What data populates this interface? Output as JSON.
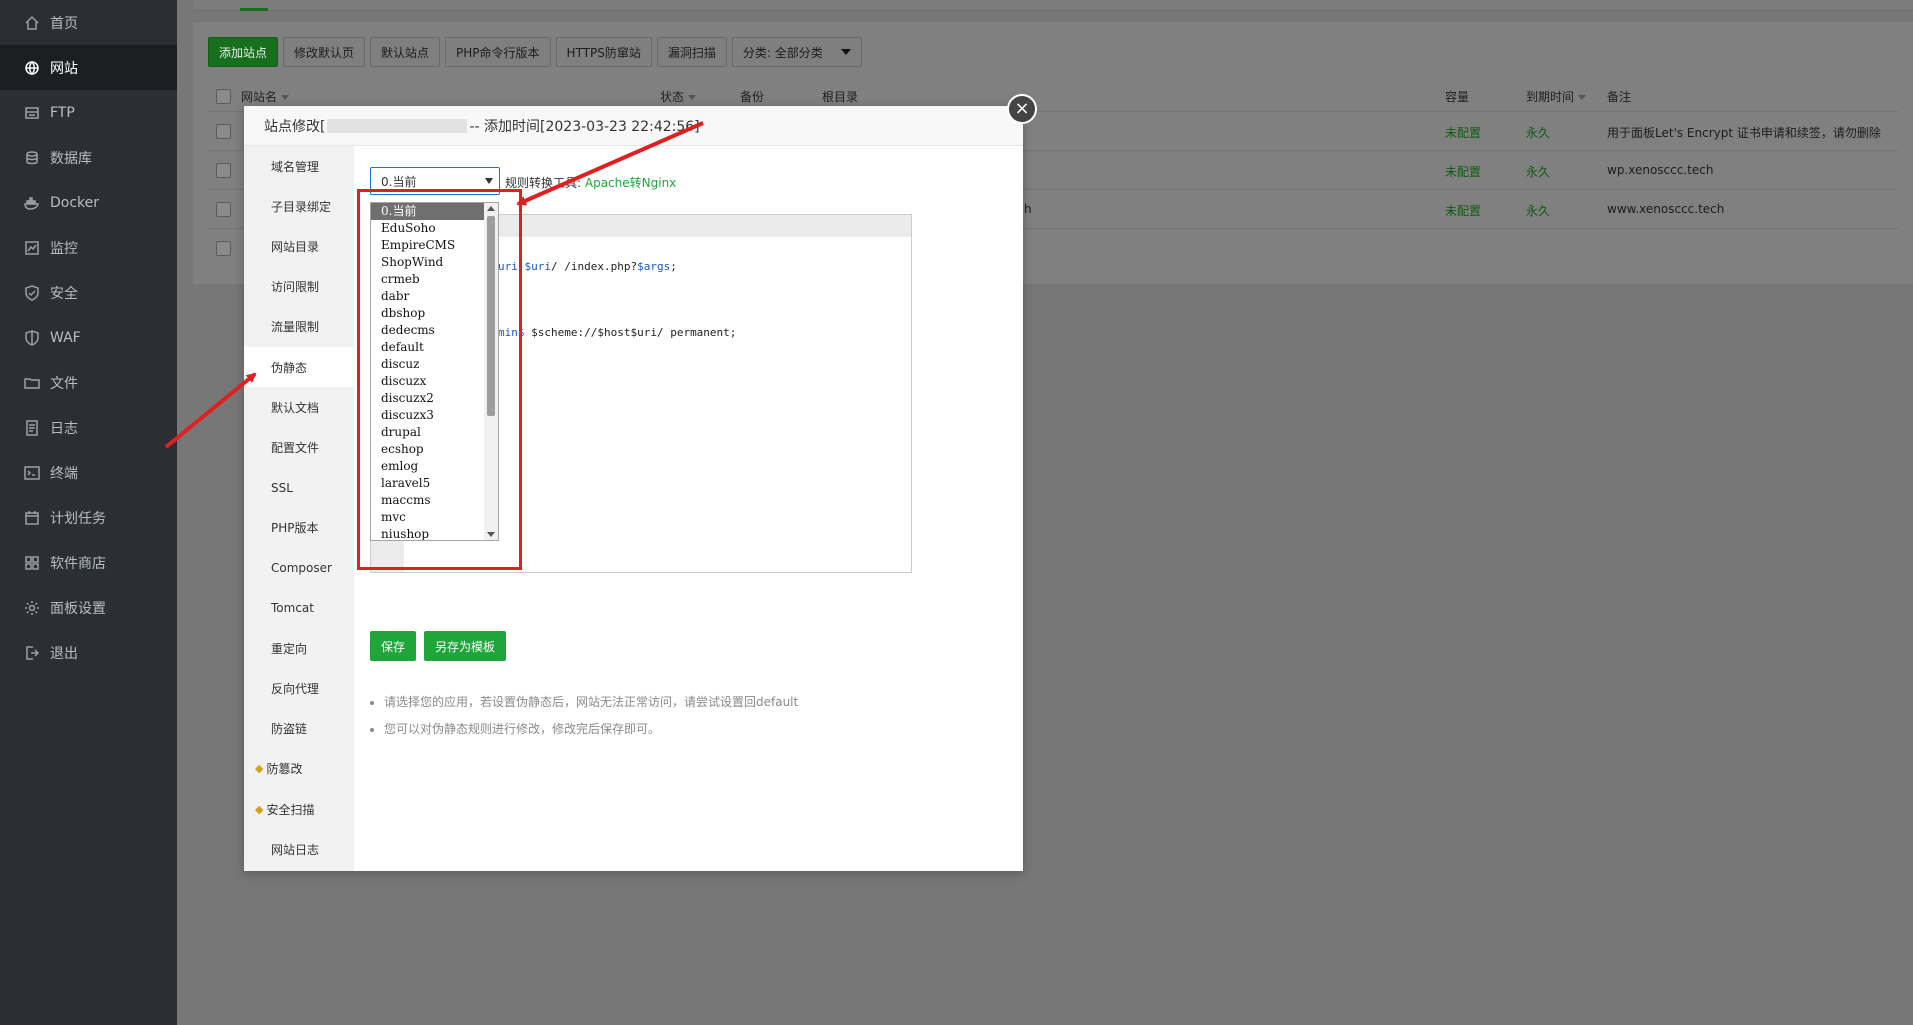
{
  "sidebar": {
    "items": [
      {
        "label": "首页",
        "icon": "home-icon"
      },
      {
        "label": "网站",
        "icon": "globe-icon"
      },
      {
        "label": "FTP",
        "icon": "ftp-icon"
      },
      {
        "label": "数据库",
        "icon": "database-icon"
      },
      {
        "label": "Docker",
        "icon": "docker-icon"
      },
      {
        "label": "监控",
        "icon": "monitor-icon"
      },
      {
        "label": "安全",
        "icon": "shield-icon"
      },
      {
        "label": "WAF",
        "icon": "waf-shield-icon"
      },
      {
        "label": "文件",
        "icon": "folder-icon"
      },
      {
        "label": "日志",
        "icon": "log-icon"
      },
      {
        "label": "终端",
        "icon": "terminal-icon"
      },
      {
        "label": "计划任务",
        "icon": "calendar-icon"
      },
      {
        "label": "软件商店",
        "icon": "apps-icon"
      },
      {
        "label": "面板设置",
        "icon": "gear-icon"
      },
      {
        "label": "退出",
        "icon": "logout-icon"
      }
    ],
    "active_index": 1
  },
  "toolbar": {
    "add_site": "添加站点",
    "edit_default_page": "修改默认页",
    "default_site": "默认站点",
    "php_cli_version": "PHP命令行版本",
    "https_anti_scan": "HTTPS防窜站",
    "vuln_scan": "漏洞扫描",
    "category": "分类: 全部分类"
  },
  "table": {
    "headers": {
      "site_name": "网站名",
      "status": "状态",
      "backup": "备份",
      "root_dir": "根目录",
      "capacity": "容量",
      "expire": "到期时间",
      "note": "备注"
    },
    "rows": [
      {
        "capacity": "未配置",
        "expire": "永久",
        "note": "用于面板Let's Encrypt 证书申请和续签，请勿删除"
      },
      {
        "capacity": "未配置",
        "expire": "永久",
        "note": "wp.xenosccc.tech"
      },
      {
        "capacity": "未配置",
        "expire": "永久",
        "note": "www.xenosccc.tech",
        "root_fragment": "h"
      }
    ]
  },
  "modal": {
    "title_prefix": "站点修改[",
    "title_suffix": "-- 添加时间[2023-03-23 22:42:56]",
    "close": "×",
    "tabs": [
      "域名管理",
      "子目录绑定",
      "网站目录",
      "访问限制",
      "流量限制",
      "伪静态",
      "默认文档",
      "配置文件",
      "SSL",
      "PHP版本",
      "Composer",
      "Tomcat",
      "重定向",
      "反向代理",
      "防盗链",
      "防篡改",
      "安全扫描",
      "网站日志"
    ],
    "active_tab": 5,
    "rewrite": {
      "selected": "0.当前",
      "convert_label": "规则转换工具:",
      "convert_link": "Apache转Nginx",
      "options": [
        "0.当前",
        "EduSoho",
        "EmpireCMS",
        "ShopWind",
        "crmeb",
        "dabr",
        "dbshop",
        "dedecms",
        "default",
        "discuz",
        "discuzx",
        "discuzx2",
        "discuzx3",
        "drupal",
        "ecshop",
        "emlog",
        "laravel5",
        "maccms",
        "mvc",
        "niushop"
      ],
      "code_line1_kw": "uri",
      "code_line1_var": "$uri",
      "code_line1_rest": "/ /index.php?",
      "code_line1_args": "$args",
      "code_line1_end": ";",
      "code_line2_kw": "min$",
      "code_line2_rest": " $scheme://$host$uri/ permanent;",
      "save": "保存",
      "save_as_template": "另存为模板",
      "tips": [
        "请选择您的应用，若设置伪静态后，网站无法正常访问，请尝试设置回default",
        "您可以对伪静态规则进行修改，修改完后保存即可。"
      ]
    }
  },
  "colors": {
    "sidebar_bg": "#2b2f33",
    "brand_green": "#20a53a",
    "annotation_red": "#e02020"
  }
}
